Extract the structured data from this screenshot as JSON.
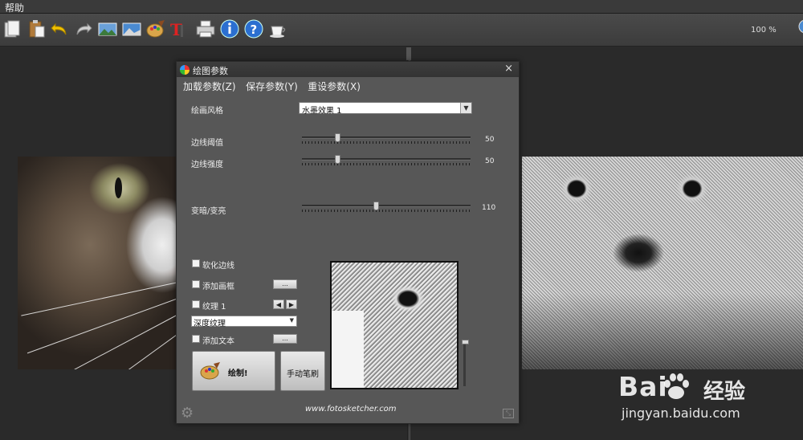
{
  "menu": {
    "help_label": "帮助"
  },
  "toolbar": {
    "buttons": [
      "open-icon",
      "paste-icon",
      "undo-icon",
      "redo-icon",
      "landscape-icon",
      "image-icon",
      "palette-icon",
      "text-icon",
      "print-icon",
      "info-icon",
      "help-icon",
      "coffee-icon"
    ],
    "zoom": "100 %"
  },
  "dialog": {
    "title": "绘图参数",
    "close_label": "×",
    "menu": [
      "加载参数(Z)",
      "保存参数(Y)",
      "重设参数(X)"
    ],
    "style_label": "绘画风格",
    "style_value": "水墨效果 1",
    "sliders": [
      {
        "label": "边线阈值",
        "value": "50",
        "fraction": 0.2
      },
      {
        "label": "边线强度",
        "value": "50",
        "fraction": 0.2
      },
      {
        "label": "变暗/变亮",
        "value": "110",
        "fraction": 0.44
      }
    ],
    "soften_edges": "软化边线",
    "add_frame": "添加画框",
    "frame_button": "...",
    "texture_label": "纹理 1",
    "texture_value": "深度纹理",
    "add_text": "添加文本",
    "text_button": "...",
    "draw_button": "绘制!",
    "manual_button": "手动笔刷",
    "website": "www.fotosketcher.com"
  },
  "watermark": {
    "brand": "Bai",
    "brand_cn": "经验",
    "url": "jingyan.baidu.com"
  }
}
